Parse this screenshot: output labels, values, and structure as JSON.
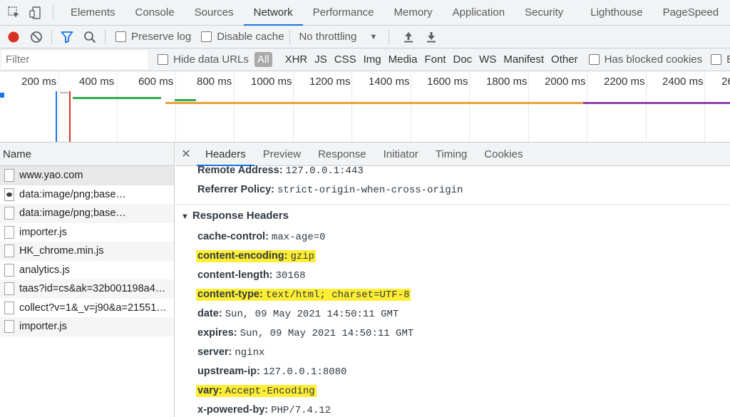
{
  "topbar": {
    "tabs": [
      "Elements",
      "Console",
      "Sources",
      "Network",
      "Performance",
      "Memory",
      "Application",
      "Security",
      "Lighthouse",
      "PageSpeed"
    ],
    "active_tab": "Network"
  },
  "toolbar": {
    "preserve_log": "Preserve log",
    "disable_cache": "Disable cache",
    "throttling": "No throttling"
  },
  "filterbar": {
    "placeholder": "Filter",
    "hide_data_urls": "Hide data URLs",
    "types": [
      "All",
      "XHR",
      "JS",
      "CSS",
      "Img",
      "Media",
      "Font",
      "Doc",
      "WS",
      "Manifest",
      "Other"
    ],
    "has_blocked_cookies": "Has blocked cookies",
    "extra": "B"
  },
  "overview": {
    "ticks": [
      "200 ms",
      "400 ms",
      "600 ms",
      "800 ms",
      "1000 ms",
      "1200 ms",
      "1400 ms",
      "1600 ms",
      "1800 ms",
      "2000 ms",
      "2200 ms",
      "2400 ms",
      "26"
    ]
  },
  "namecol": {
    "header": "Name",
    "rows": [
      "www.yao.com",
      "data:image/png;base…",
      "data:image/png;base…",
      "importer.js",
      "HK_chrome.min.js",
      "analytics.js",
      "taas?id=cs&ak=32b001198a4…",
      "collect?v=1&_v=j90&a=21551…",
      "importer.js"
    ]
  },
  "details": {
    "tabs": [
      "Headers",
      "Preview",
      "Response",
      "Initiator",
      "Timing",
      "Cookies"
    ],
    "active_tab": "Headers",
    "general": [
      {
        "key": "Remote Address:",
        "value": "127.0.0.1:443"
      },
      {
        "key": "Referrer Policy:",
        "value": "strict-origin-when-cross-origin"
      }
    ],
    "section_title": "Response Headers",
    "response_headers": [
      {
        "key": "cache-control:",
        "value": "max-age=0",
        "highlight": false
      },
      {
        "key": "content-encoding:",
        "value": "gzip",
        "highlight": true
      },
      {
        "key": "content-length:",
        "value": "30168",
        "highlight": false
      },
      {
        "key": "content-type:",
        "value": "text/html; charset=UTF-8",
        "highlight": true
      },
      {
        "key": "date:",
        "value": "Sun, 09 May 2021 14:50:11 GMT",
        "highlight": false
      },
      {
        "key": "expires:",
        "value": "Sun, 09 May 2021 14:50:11 GMT",
        "highlight": false
      },
      {
        "key": "server:",
        "value": "nginx",
        "highlight": false
      },
      {
        "key": "upstream-ip:",
        "value": "127.0.0.1:8080",
        "highlight": false
      },
      {
        "key": "vary:",
        "value": "Accept-Encoding",
        "highlight": true
      },
      {
        "key": "x-powered-by:",
        "value": "PHP/7.4.12",
        "highlight": false
      }
    ]
  },
  "colors": {
    "accent": "#1a73e8",
    "record": "#d93025",
    "highlight": "#ffee33",
    "waterfall_green": "#34a853",
    "waterfall_orange": "#e8a33d",
    "waterfall_purple": "#8e44ad"
  }
}
